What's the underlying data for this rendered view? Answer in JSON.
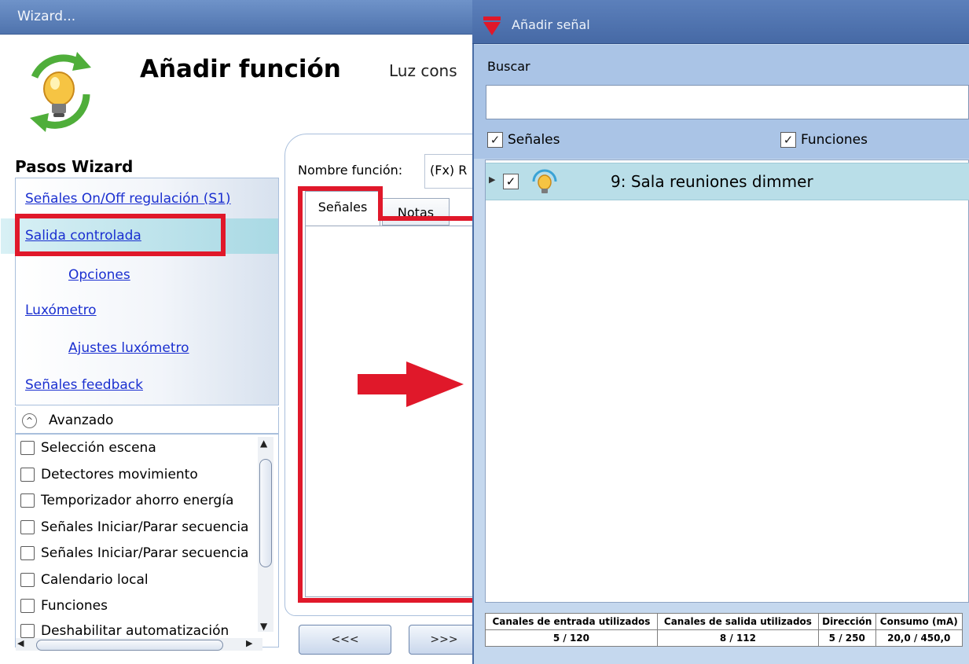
{
  "wizard": {
    "title": "Wizard...",
    "function_title": "Añadir función",
    "function_subtitle": "Luz cons",
    "steps_title": "Pasos Wizard",
    "steps": [
      {
        "label": "Señales On/Off regulación (S1)"
      },
      {
        "label": "Salida controlada",
        "selected": true
      },
      {
        "label": "Opciones"
      },
      {
        "label": "Luxómetro"
      },
      {
        "label": "Ajustes luxómetro"
      },
      {
        "label": "Señales feedback"
      }
    ],
    "advanced_label": "Avanzado",
    "advanced_items": [
      "Selección escena",
      "Detectores movimiento",
      "Temporizador ahorro energía",
      "Señales Iniciar/Parar secuencia",
      "Señales Iniciar/Parar secuencia",
      "Calendario local",
      "Funciones",
      "Deshabilitar automatización"
    ],
    "function_name_label": "Nombre función:",
    "function_name_value": "(Fx) R",
    "tabs": [
      "Señales",
      "Notas"
    ],
    "back_button": "<<<",
    "next_button": ">>>"
  },
  "dialog": {
    "title": "Añadir señal",
    "search_label": "Buscar",
    "search_value": "",
    "filter_signals": {
      "label": "Señales",
      "checked": true
    },
    "filter_functions": {
      "label": "Funciones",
      "checked": true
    },
    "results": [
      {
        "label": "9: Sala reuniones dimmer",
        "checked": true,
        "icon": "bulb-icon"
      }
    ],
    "usage": {
      "headers": [
        "Canales de entrada utilizados",
        "Canales de salida utilizados",
        "Dirección",
        "Consumo (mA)"
      ],
      "values": [
        "5 / 120",
        "8 / 112",
        "5 / 250",
        "20,0 / 450,0"
      ]
    }
  },
  "colors": {
    "annotation_red": "#e0182a",
    "link_blue": "#1a2fd0",
    "dialog_bg": "#aac4e6",
    "selected_row": "#b9dee8"
  }
}
